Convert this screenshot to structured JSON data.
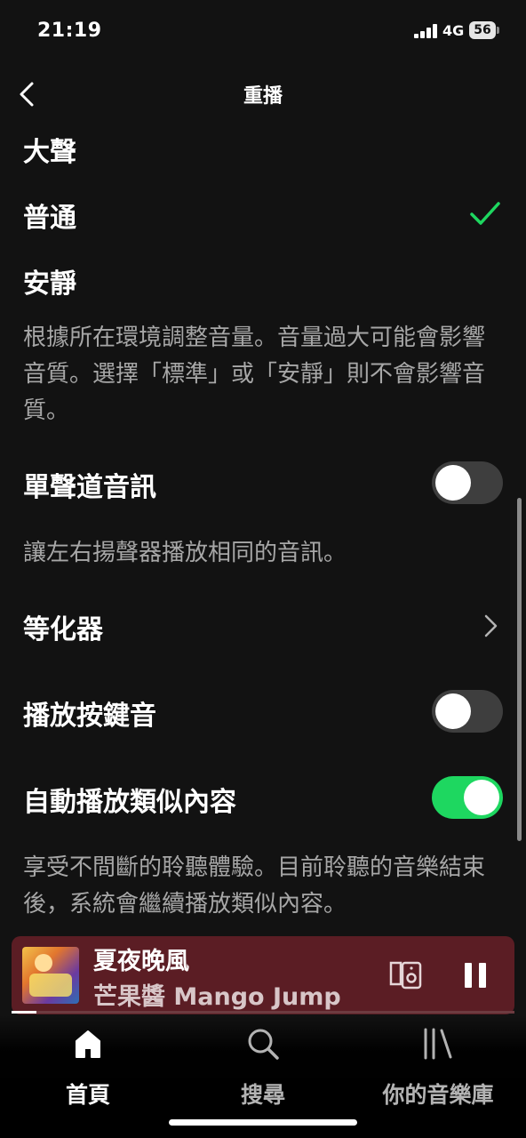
{
  "status_bar": {
    "time": "21:19",
    "network": "4G",
    "battery": "56"
  },
  "header": {
    "title": "重播",
    "back_icon": "chevron-left-icon"
  },
  "volume_levels": {
    "options": [
      "大聲",
      "普通",
      "安靜"
    ],
    "selected": "普通",
    "description": "根據所在環境調整音量。音量過大可能會影響音質。選擇「標準」或「安靜」則不會影響音質。"
  },
  "settings": {
    "mono_audio": {
      "label": "單聲道音訊",
      "enabled": false,
      "description": "讓左右揚聲器播放相同的音訊。"
    },
    "equalizer": {
      "label": "等化器",
      "icon": "chevron-right-icon"
    },
    "playback_sounds": {
      "label": "播放按鍵音",
      "enabled": false
    },
    "autoplay": {
      "label": "自動播放類似內容",
      "enabled": true,
      "description": "享受不間斷的聆聽體驗。目前聆聽的音樂結束後，系統會繼續播放類似內容。"
    }
  },
  "now_playing": {
    "title": "夏夜晚風",
    "artist": "芒果醬 Mango Jump",
    "progress": 0.05,
    "device_icon": "connect-device-icon",
    "pause_icon": "pause-icon"
  },
  "tab_bar": {
    "items": [
      {
        "label": "首頁",
        "icon": "home-icon",
        "active": true
      },
      {
        "label": "搜尋",
        "icon": "search-icon",
        "active": false
      },
      {
        "label": "你的音樂庫",
        "icon": "library-icon",
        "active": false
      }
    ]
  },
  "colors": {
    "accent": "#1ed760",
    "background": "#121212",
    "mini_player": "#5b1d24",
    "secondary_text": "#a7a7a7"
  }
}
